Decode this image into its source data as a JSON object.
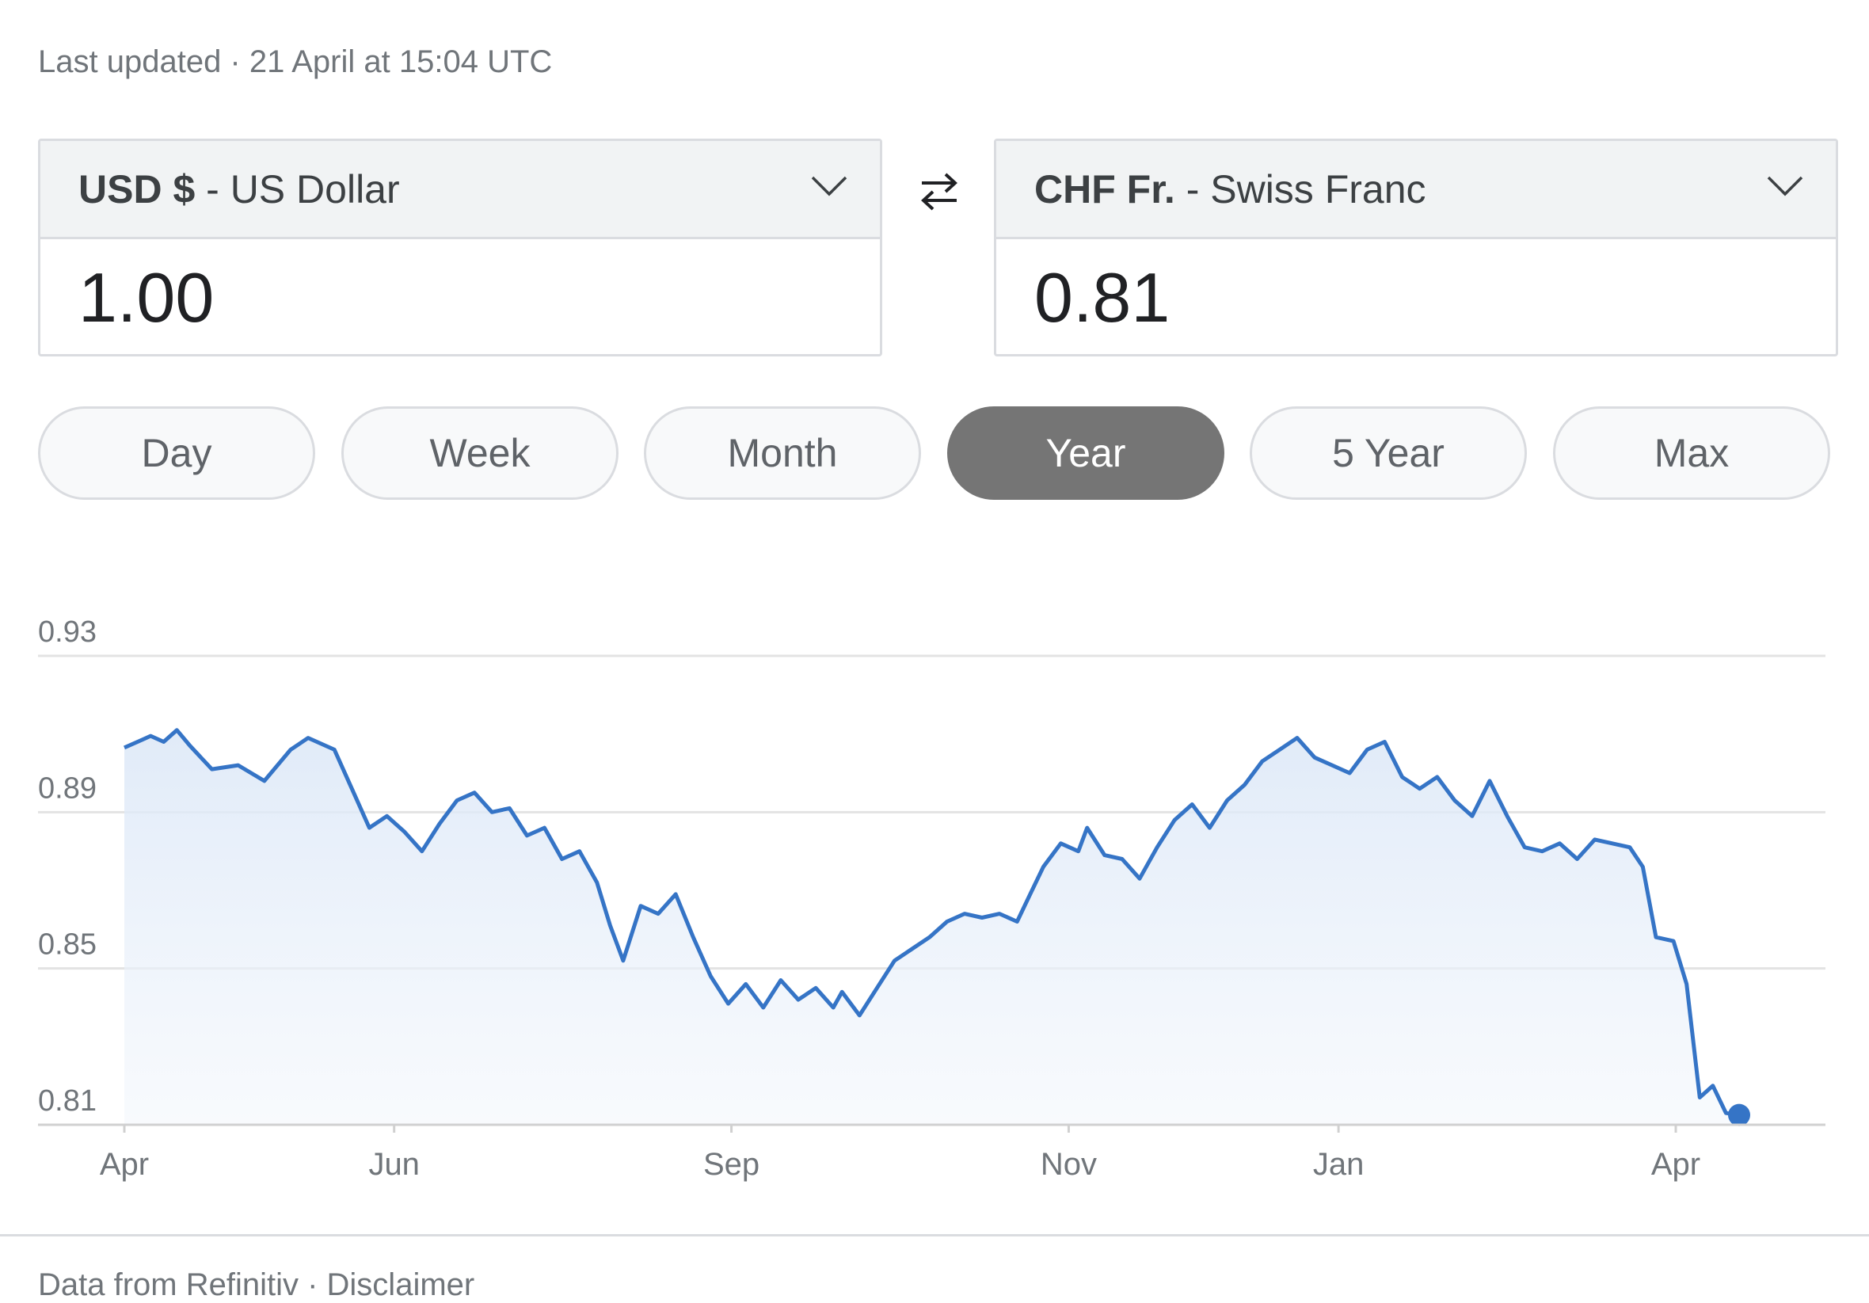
{
  "last_updated": "Last updated · 21 April at 15:04 UTC",
  "from": {
    "code": "USD $",
    "name": " - US Dollar",
    "value": "1.00"
  },
  "to": {
    "code": "CHF Fr.",
    "name": " - Swiss Franc",
    "value": "0.81"
  },
  "icons": {
    "swap": "swap-arrows-icon",
    "dropdown": "chevron-down-icon"
  },
  "ranges": [
    {
      "label": "Day",
      "active": false
    },
    {
      "label": "Week",
      "active": false
    },
    {
      "label": "Month",
      "active": false
    },
    {
      "label": "Year",
      "active": true
    },
    {
      "label": "5 Year",
      "active": false
    },
    {
      "label": "Max",
      "active": false
    }
  ],
  "colors": {
    "line": "#3574c6",
    "active_range": "#757575"
  },
  "chart_data": {
    "type": "area",
    "yticks": [
      "0.93",
      "0.89",
      "0.85",
      "0.81"
    ],
    "ylim": [
      0.81,
      0.93
    ],
    "xticks": [
      "Apr",
      "Jun",
      "Sep",
      "Nov",
      "Jan",
      "Apr"
    ],
    "xtick_positions": [
      0,
      2,
      4.5,
      7,
      9,
      11.5
    ],
    "xlim": [
      0,
      11.5
    ],
    "grid": true,
    "series": [
      {
        "values": [
          [
            0.0,
            0.9065
          ],
          [
            0.2,
            0.9085
          ],
          [
            0.3,
            0.9095
          ],
          [
            0.45,
            0.908
          ],
          [
            0.6,
            0.911
          ],
          [
            0.75,
            0.907
          ],
          [
            1.0,
            0.901
          ],
          [
            1.3,
            0.902
          ],
          [
            1.6,
            0.898
          ],
          [
            1.9,
            0.906
          ],
          [
            2.1,
            0.909
          ],
          [
            2.4,
            0.906
          ],
          [
            2.6,
            0.896
          ],
          [
            2.8,
            0.886
          ],
          [
            3.0,
            0.889
          ],
          [
            3.2,
            0.885
          ],
          [
            3.4,
            0.88
          ],
          [
            3.6,
            0.887
          ],
          [
            3.8,
            0.893
          ],
          [
            4.0,
            0.895
          ],
          [
            4.2,
            0.89
          ],
          [
            4.4,
            0.891
          ],
          [
            4.6,
            0.884
          ],
          [
            4.8,
            0.886
          ],
          [
            5.0,
            0.878
          ],
          [
            5.2,
            0.88
          ],
          [
            5.4,
            0.872
          ],
          [
            5.55,
            0.861
          ],
          [
            5.7,
            0.852
          ],
          [
            5.9,
            0.866
          ],
          [
            6.1,
            0.864
          ],
          [
            6.3,
            0.869
          ],
          [
            6.5,
            0.858
          ],
          [
            6.7,
            0.848
          ],
          [
            6.9,
            0.841
          ],
          [
            7.1,
            0.846
          ],
          [
            7.3,
            0.84
          ],
          [
            7.5,
            0.847
          ],
          [
            7.7,
            0.842
          ],
          [
            7.9,
            0.845
          ],
          [
            8.1,
            0.84
          ],
          [
            8.2,
            0.844
          ],
          [
            8.4,
            0.838
          ],
          [
            8.6,
            0.845
          ],
          [
            8.8,
            0.852
          ],
          [
            9.0,
            0.855
          ],
          [
            9.2,
            0.858
          ],
          [
            9.4,
            0.862
          ],
          [
            9.6,
            0.864
          ],
          [
            9.8,
            0.863
          ],
          [
            10.0,
            0.864
          ],
          [
            10.2,
            0.862
          ],
          [
            10.35,
            0.869
          ],
          [
            10.5,
            0.876
          ],
          [
            10.7,
            0.882
          ],
          [
            10.9,
            0.88
          ],
          [
            11.0,
            0.886
          ],
          [
            11.2,
            0.879
          ],
          [
            11.4,
            0.878
          ],
          [
            11.6,
            0.873
          ],
          [
            11.8,
            0.881
          ],
          [
            12.0,
            0.888
          ],
          [
            12.2,
            0.892
          ],
          [
            12.4,
            0.886
          ],
          [
            12.6,
            0.893
          ],
          [
            12.8,
            0.897
          ],
          [
            13.0,
            0.903
          ],
          [
            13.2,
            0.906
          ],
          [
            13.4,
            0.909
          ],
          [
            13.6,
            0.904
          ],
          [
            13.8,
            0.902
          ],
          [
            14.0,
            0.9
          ],
          [
            14.2,
            0.906
          ],
          [
            14.4,
            0.908
          ],
          [
            14.6,
            0.899
          ],
          [
            14.8,
            0.896
          ],
          [
            15.0,
            0.899
          ],
          [
            15.2,
            0.893
          ],
          [
            15.4,
            0.889
          ],
          [
            15.6,
            0.898
          ],
          [
            15.8,
            0.889
          ],
          [
            16.0,
            0.881
          ],
          [
            16.2,
            0.88
          ],
          [
            16.4,
            0.882
          ],
          [
            16.6,
            0.878
          ],
          [
            16.8,
            0.883
          ],
          [
            17.0,
            0.882
          ],
          [
            17.2,
            0.881
          ],
          [
            17.35,
            0.876
          ],
          [
            17.5,
            0.858
          ],
          [
            17.7,
            0.857
          ],
          [
            17.85,
            0.846
          ],
          [
            18.0,
            0.817
          ],
          [
            18.15,
            0.82
          ],
          [
            18.3,
            0.813
          ],
          [
            18.45,
            0.8125
          ]
        ]
      }
    ]
  },
  "footer": "Data from Refinitiv · Disclaimer"
}
